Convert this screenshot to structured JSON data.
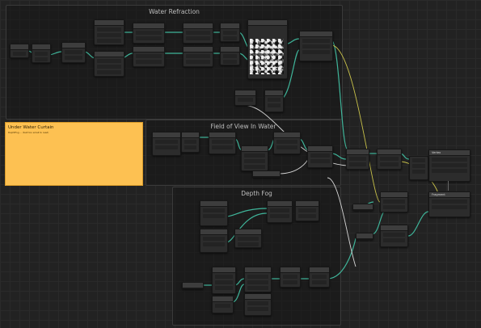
{
  "groups": {
    "water_refraction": "Water Refraction",
    "field_of_view": "Field of View In Water",
    "depth_fog": "Depth Fog"
  },
  "sticky_note": {
    "title": "Under Water Curtain",
    "body": "DepthFog ... (text too small to read)"
  },
  "master_stack": {
    "vertex_label": "Vertex",
    "fragment_label": "Fragment",
    "vertex_slots": [
      "Position",
      "Normal",
      "Tangent"
    ],
    "fragment_slots": [
      "Base Color",
      "Alpha"
    ],
    "side_ports": [
      "Position",
      "Normal",
      "Tangent"
    ]
  },
  "colors": {
    "accent_wire_green": "#3fb59a",
    "wire_yellow": "#c9c24a",
    "wire_white": "#d6d6d6",
    "note_yellow": "#fdc152"
  }
}
